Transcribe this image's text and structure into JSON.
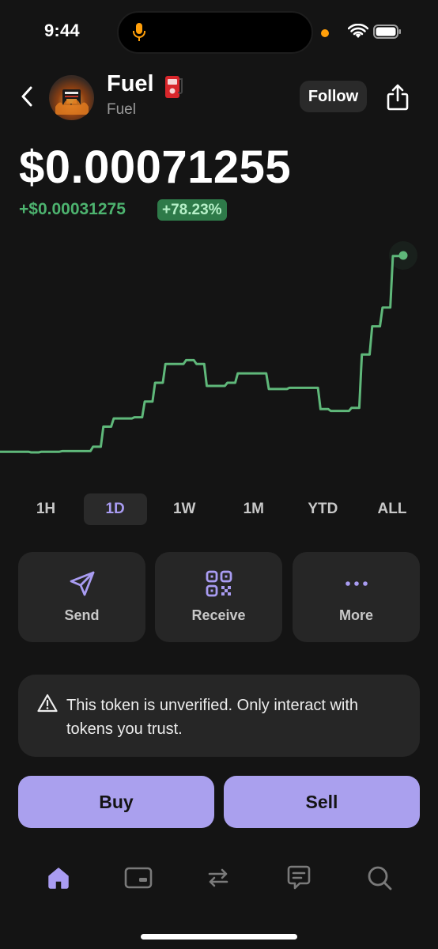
{
  "status_bar": {
    "time": "9:44",
    "icons": [
      "mic-icon",
      "wifi-icon",
      "battery-icon"
    ]
  },
  "header": {
    "token_name": "Fuel",
    "token_symbol": "Fuel",
    "follow_label": "Follow",
    "icons": [
      "back-icon",
      "share-icon",
      "fuel-pump-icon"
    ]
  },
  "price": {
    "value": "$0.00071255",
    "change_amount": "+$0.00031275",
    "change_percent": "+78.23%"
  },
  "chart_data": {
    "type": "line",
    "range": "1D",
    "series_color": "#5fb87a",
    "grid": false,
    "x": [
      0,
      1,
      2,
      3,
      4,
      5,
      6,
      7,
      8,
      9,
      10,
      11,
      12,
      13,
      14,
      15,
      16,
      17,
      18,
      19,
      20,
      21,
      22,
      23,
      24,
      25,
      26,
      27,
      28,
      29,
      30,
      31,
      32,
      33,
      34,
      35,
      36,
      37,
      38,
      39
    ],
    "values": [
      0.0004,
      0.0004,
      0.0004,
      0.000399,
      0.0004,
      0.0004,
      0.000401,
      0.000401,
      0.000401,
      0.000408,
      0.00044,
      0.000453,
      0.000453,
      0.000455,
      0.00048,
      0.00051,
      0.00054,
      0.00054,
      0.000546,
      0.00054,
      0.000505,
      0.000505,
      0.00051,
      0.000525,
      0.000525,
      0.000525,
      0.0005,
      0.0005,
      0.000502,
      0.000502,
      0.000502,
      0.000468,
      0.000465,
      0.000465,
      0.00047,
      0.000555,
      0.0006,
      0.00063,
      0.000712,
      0.000713
    ]
  },
  "range_tabs": [
    {
      "label": "1H",
      "active": false
    },
    {
      "label": "1D",
      "active": true
    },
    {
      "label": "1W",
      "active": false
    },
    {
      "label": "1M",
      "active": false
    },
    {
      "label": "YTD",
      "active": false
    },
    {
      "label": "ALL",
      "active": false
    }
  ],
  "actions": [
    {
      "label": "Send",
      "icon": "send-icon"
    },
    {
      "label": "Receive",
      "icon": "qr-code-icon"
    },
    {
      "label": "More",
      "icon": "more-dots-icon"
    }
  ],
  "warning": {
    "icon": "warning-triangle-icon",
    "text": "This token is unverified. Only interact with tokens you trust."
  },
  "trade": {
    "buy_label": "Buy",
    "sell_label": "Sell"
  },
  "bottom_nav": [
    {
      "icon": "home-icon",
      "active": true
    },
    {
      "icon": "card-icon",
      "active": false
    },
    {
      "icon": "swap-icon",
      "active": false
    },
    {
      "icon": "chat-icon",
      "active": false
    },
    {
      "icon": "search-icon",
      "active": false
    }
  ],
  "colors": {
    "background": "#141414",
    "accent": "#aaa0ee",
    "positive": "#4db36f",
    "card": "#262626"
  }
}
